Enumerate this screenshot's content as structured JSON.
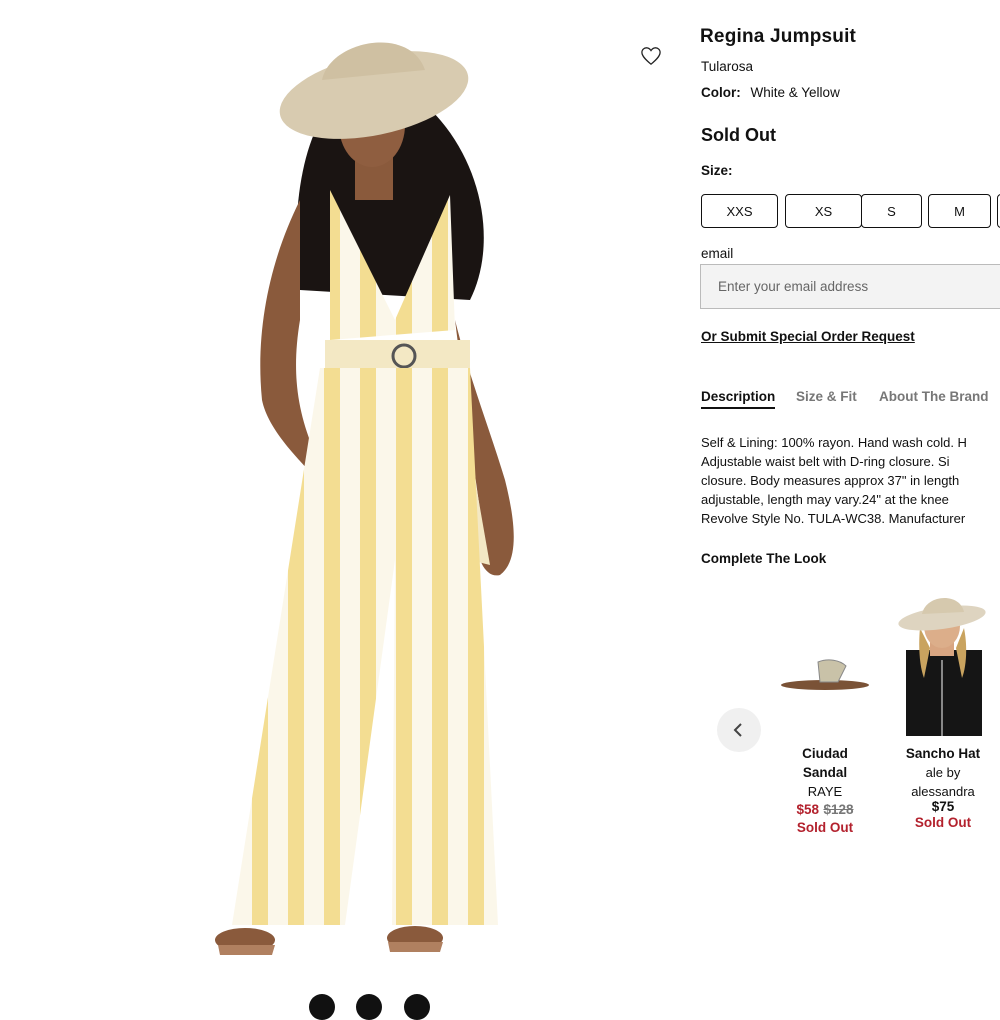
{
  "product": {
    "title": "Regina Jumpsuit",
    "brand": "Tularosa",
    "color_label": "Color:",
    "color_value": "White & Yellow",
    "status": "Sold Out",
    "size_label": "Size:",
    "sizes": [
      "XXS",
      "XS",
      "S",
      "M"
    ]
  },
  "email": {
    "label": "email",
    "placeholder": "Enter your email address"
  },
  "special_order_link": "Or Submit Special Order Request",
  "tabs": [
    {
      "label": "Description",
      "active": true
    },
    {
      "label": "Size & Fit",
      "active": false
    },
    {
      "label": "About The Brand",
      "active": false
    }
  ],
  "description_lines": [
    "Self & Lining: 100% rayon. Hand wash cold. H",
    "Adjustable waist belt with D-ring closure. Si",
    "closure. Body measures approx 37\" in length",
    "adjustable, length may vary.24\" at the knee",
    "Revolve Style No. TULA-WC38. Manufacturer"
  ],
  "complete_the_look": {
    "heading": "Complete The Look",
    "items": [
      {
        "name_line1": "Ciudad",
        "name_line2": "Sandal",
        "brand_line1": "RAYE",
        "price": "$58",
        "original_price": "$128",
        "status": "Sold Out"
      },
      {
        "name_line1": "Sancho Hat",
        "brand_line1": "ale by",
        "brand_line2": "alessandra",
        "price": "$75",
        "status": "Sold Out"
      }
    ]
  },
  "icons": {
    "wishlist": "heart-outline-icon",
    "carousel_prev": "chevron-left-icon"
  },
  "colors": {
    "sale_red": "#b3212d",
    "stripe_yellow": "#f3dd92",
    "input_bg": "#f3f3f3"
  }
}
